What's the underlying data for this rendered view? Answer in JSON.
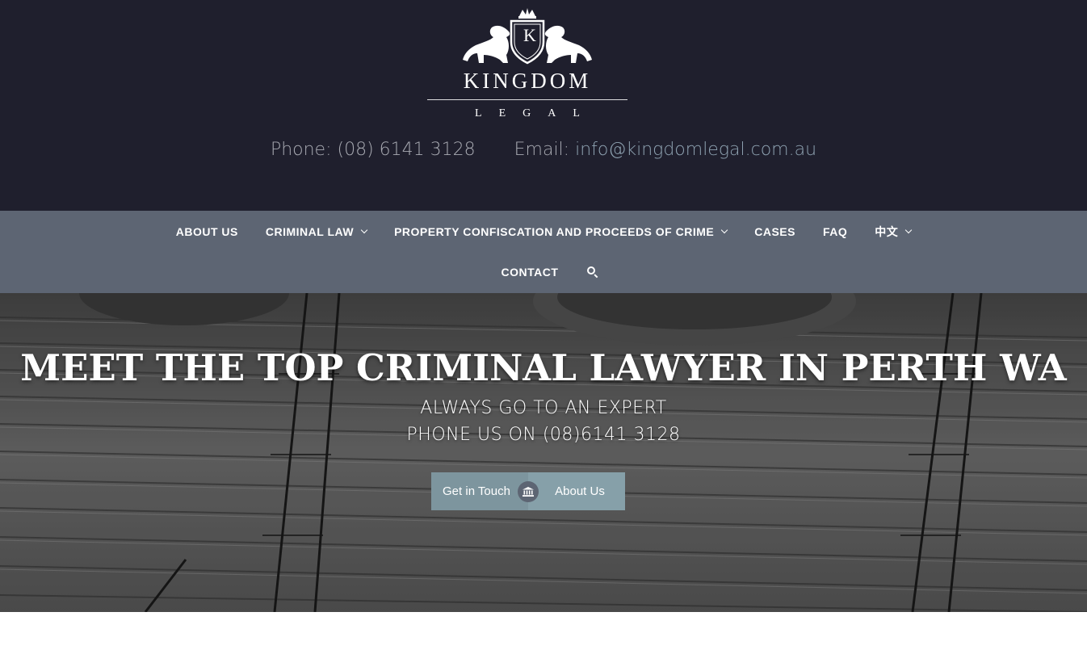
{
  "brand": {
    "name": "KINGDOM",
    "sub": "LEGAL",
    "crest_letter": "K"
  },
  "contact": {
    "phone_label": "Phone:",
    "phone_value": "(08) 6141 3128",
    "email_label": "Email:",
    "email_value": "info@kingdomlegal.com.au"
  },
  "nav": {
    "items": [
      {
        "label": "ABOUT US",
        "dropdown": false
      },
      {
        "label": "CRIMINAL LAW",
        "dropdown": true
      },
      {
        "label": "PROPERTY CONFISCATION AND PROCEEDS OF CRIME",
        "dropdown": true
      },
      {
        "label": "CASES",
        "dropdown": false
      },
      {
        "label": "FAQ",
        "dropdown": false
      },
      {
        "label": "中文",
        "dropdown": true
      },
      {
        "label": "CONTACT",
        "dropdown": false
      }
    ],
    "search_icon": "search-icon"
  },
  "hero": {
    "title": "MEET THE TOP CRIMINAL LAWYER IN PERTH WA",
    "subtitle_1": "ALWAYS GO TO AN EXPERT",
    "subtitle_2": "PHONE US ON (08)6141 3128",
    "button_left": "Get in Touch",
    "button_right": "About Us",
    "divider_icon": "courthouse-icon"
  },
  "colors": {
    "header_bg": "#1f1f2d",
    "nav_bg": "#5d6573",
    "button_bg": "#7d959e",
    "link": "#8fa3b2"
  }
}
